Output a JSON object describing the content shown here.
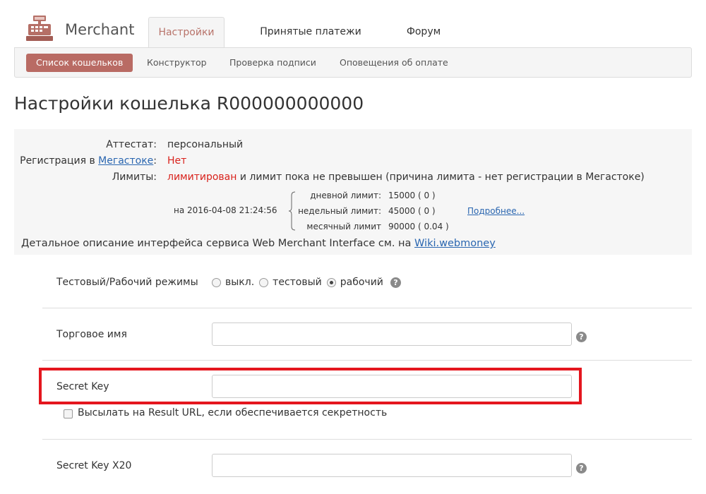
{
  "header": {
    "brand": "Merchant",
    "tabs": [
      {
        "label": "Настройки",
        "active": true
      },
      {
        "label": "Принятые платежи",
        "active": false
      },
      {
        "label": "Форум",
        "active": false
      }
    ],
    "subnav": [
      {
        "label": "Список кошельков",
        "active": true
      },
      {
        "label": "Конструктор",
        "active": false
      },
      {
        "label": "Проверка подписи",
        "active": false
      },
      {
        "label": "Оповещения об оплате",
        "active": false
      }
    ]
  },
  "page_title": "Настройки кошелька R000000000000",
  "info": {
    "attestat_label": "Аттестат:",
    "attestat_value": "персональный",
    "registration_label_prefix": "Регистрация в ",
    "registration_link": "Мегастоке",
    "registration_label_suffix": ":",
    "registration_value": "Нет",
    "limits_label": "Лимиты:",
    "limits_status": "лимитирован",
    "limits_text": " и лимит пока не превышен (причина лимита - нет регистрации в Мегастоке)",
    "limits_date": "на 2016-04-08 21:24:56",
    "limits": [
      {
        "label": "дневной лимит:",
        "value": "15000 ( 0 )"
      },
      {
        "label": "недельный лимит:",
        "value": "45000 ( 0 )"
      },
      {
        "label": "месячный лимит",
        "value": "90000 ( 0.04 )"
      }
    ],
    "more_link": "Подробнее...",
    "description_text": "Детальное описание интерфейса сервиса Web Merchant Interface см. на ",
    "description_link": "Wiki.webmoney"
  },
  "form": {
    "mode_label": "Тестовый/Рабочий режимы",
    "mode_options": [
      {
        "label": "выкл.",
        "checked": false
      },
      {
        "label": "тестовый",
        "checked": false
      },
      {
        "label": "рабочий",
        "checked": true
      }
    ],
    "trade_name_label": "Торговое имя",
    "trade_name_value": "",
    "secret_key_label": "Secret Key",
    "secret_key_value": "",
    "send_result_label": "Высылать на Result URL, если обеспечивается секретность",
    "send_result_checked": false,
    "secret_key_x20_label": "Secret Key X20",
    "secret_key_x20_value": "",
    "help_glyph": "?"
  },
  "colors": {
    "accent": "#b96b64",
    "tab_active_text": "#b8736a",
    "link": "#2a66b0",
    "status_red": "#d9221c",
    "highlight_border": "#e4161e"
  }
}
